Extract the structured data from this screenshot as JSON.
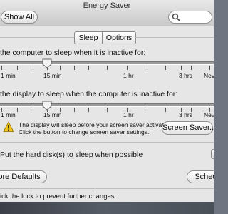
{
  "window": {
    "title": "Energy Saver"
  },
  "toolbar": {
    "show_all_label": "Show All",
    "search_placeholder": ""
  },
  "tabs": [
    {
      "label": "Sleep",
      "selected": true
    },
    {
      "label": "Options",
      "selected": false
    }
  ],
  "computer_sleep": {
    "label": "the computer to sleep when it is inactive for:",
    "ticks": [
      "1 min",
      "15 min",
      "1 hr",
      "3 hrs",
      "Nev"
    ]
  },
  "display_sleep": {
    "label": "the display to sleep when the computer is inactive for:",
    "ticks": [
      "1 min",
      "15 min",
      "1 hr",
      "3 hrs",
      "Nev"
    ]
  },
  "warning": {
    "line1": "The display will sleep before your screen saver activates.",
    "line2": "Click the button to change screen saver settings.",
    "button_label": "Screen Saver..."
  },
  "hard_disk": {
    "label": "Put the hard disk(s) to sleep when possible"
  },
  "buttons": {
    "restore_defaults": "ore Defaults",
    "schedule": "Schedu"
  },
  "lock": {
    "text": "ick the lock to prevent further changes."
  },
  "colors": {
    "window_bg": "#e6e6e6",
    "warning_yellow": "#f2c318"
  }
}
